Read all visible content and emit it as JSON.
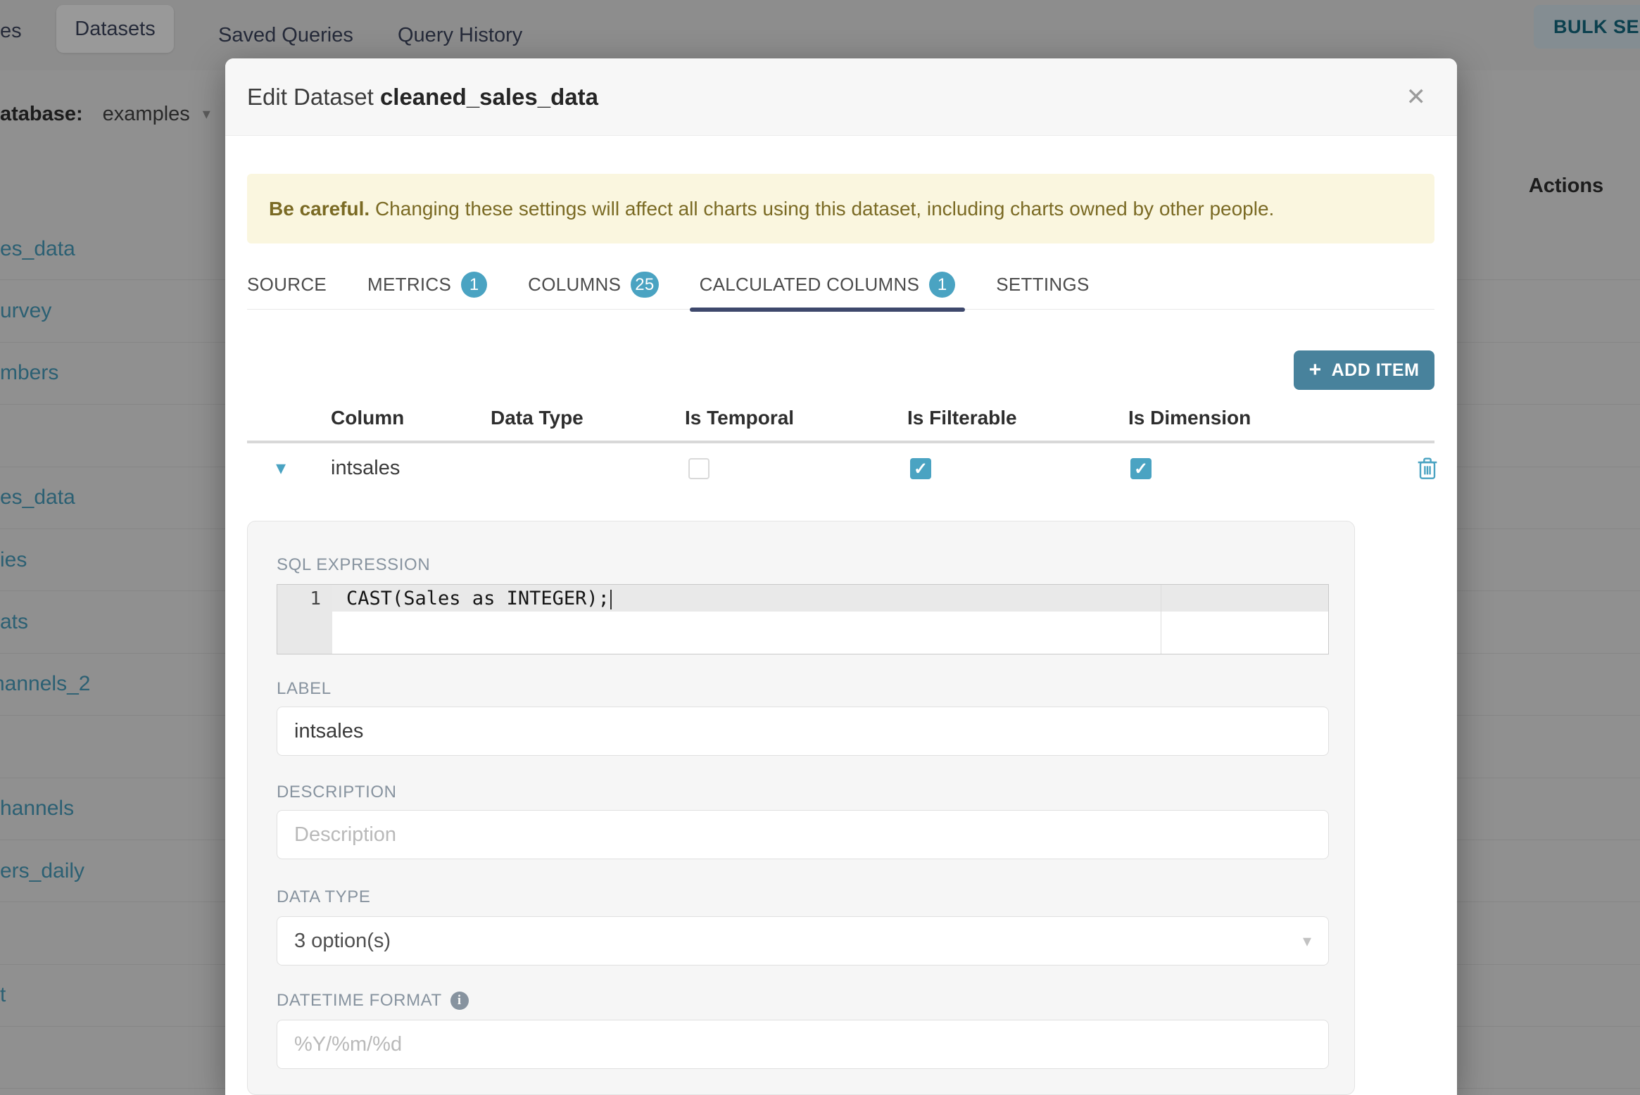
{
  "icons": {
    "caret_down": "▾",
    "close": "✕",
    "plus": "+",
    "check": "✓",
    "info": "i"
  },
  "colors": {
    "accent_blue": "#4AA3C2",
    "add_item_button": "#48829C",
    "tab_underline": "#3E486C",
    "warning_bg": "#FAF6DF",
    "warning_text": "#7A6A24",
    "link": "#4AA0C0"
  },
  "background": {
    "nav": {
      "left_tab_fragment": "es",
      "active_tab": "Datasets",
      "tab_saved_queries": "Saved Queries",
      "tab_query_history": "Query History",
      "bulk_select_label": "BULK SELE"
    },
    "filter": {
      "label_fragment": "atabase:",
      "value": "examples"
    },
    "table": {
      "actions_header": "Actions",
      "row_fragments": [
        "es_data",
        "urvey",
        "mbers",
        "",
        "es_data",
        "ies",
        "ats",
        "hannels_2",
        "",
        "hannels",
        "ers_daily",
        "",
        "t",
        ""
      ]
    }
  },
  "modal": {
    "title_prefix": "Edit Dataset",
    "title_name": "cleaned_sales_data",
    "warning": {
      "bold": "Be careful.",
      "text": " Changing these settings will affect all charts using this dataset, including charts owned by other people."
    },
    "tabs": [
      {
        "label": "SOURCE"
      },
      {
        "label": "METRICS",
        "badge": "1"
      },
      {
        "label": "COLUMNS",
        "badge": "25"
      },
      {
        "label": "CALCULATED COLUMNS",
        "badge": "1"
      },
      {
        "label": "SETTINGS"
      }
    ],
    "add_item_label": "ADD ITEM",
    "columns_table": {
      "headers": [
        "Column",
        "Data Type",
        "Is Temporal",
        "Is Filterable",
        "Is Dimension"
      ],
      "row": {
        "name": "intsales",
        "is_temporal": false,
        "is_filterable": true,
        "is_dimension": true
      }
    },
    "sql_editor": {
      "label": "SQL EXPRESSION",
      "line_number": "1",
      "code": "CAST(Sales as INTEGER);"
    },
    "fields": {
      "label": {
        "label": "LABEL",
        "value": "intsales"
      },
      "description": {
        "label": "DESCRIPTION",
        "placeholder": "Description"
      },
      "data_type": {
        "label": "DATA TYPE",
        "value": "3 option(s)"
      },
      "datetime_format": {
        "label": "DATETIME FORMAT",
        "placeholder": "%Y/%m/%d"
      }
    }
  }
}
